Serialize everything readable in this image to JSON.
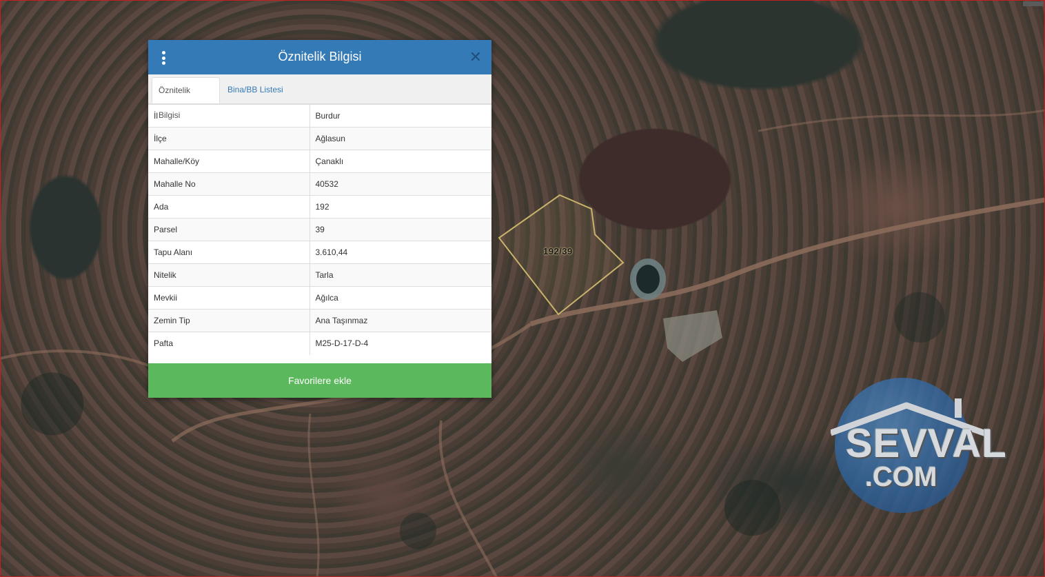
{
  "dialog": {
    "title": "Öznitelik Bilgisi",
    "menu_icon": "more-vertical-icon",
    "close_icon": "close-icon",
    "close_glyph": "✕",
    "tabs": [
      {
        "label": "Öznitelik Bilgisi",
        "active": true
      },
      {
        "label": "Bina/BB Listesi",
        "active": false
      }
    ],
    "rows": [
      {
        "key": "İl",
        "value": "Burdur"
      },
      {
        "key": "İlçe",
        "value": "Ağlasun"
      },
      {
        "key": "Mahalle/Köy",
        "value": "Çanaklı"
      },
      {
        "key": "Mahalle No",
        "value": "40532"
      },
      {
        "key": "Ada",
        "value": "192"
      },
      {
        "key": "Parsel",
        "value": "39"
      },
      {
        "key": "Tapu Alanı",
        "value": "3.610,44"
      },
      {
        "key": "Nitelik",
        "value": "Tarla"
      },
      {
        "key": "Mevkii",
        "value": "Ağılca"
      },
      {
        "key": "Zemin Tip",
        "value": "Ana Taşınmaz"
      },
      {
        "key": "Pafta",
        "value": "M25-D-17-D-4"
      }
    ],
    "favorite_button": "Favorilere ekle"
  },
  "map": {
    "parcel_label": "192/39",
    "parcel_outline_color": "#c8b46a"
  },
  "watermark": {
    "line1": "SEVVAL",
    "line2": ".COM"
  },
  "colors": {
    "header": "#337ab7",
    "favorite_button": "#5cb85c",
    "frame_border": "#c61f1f"
  }
}
